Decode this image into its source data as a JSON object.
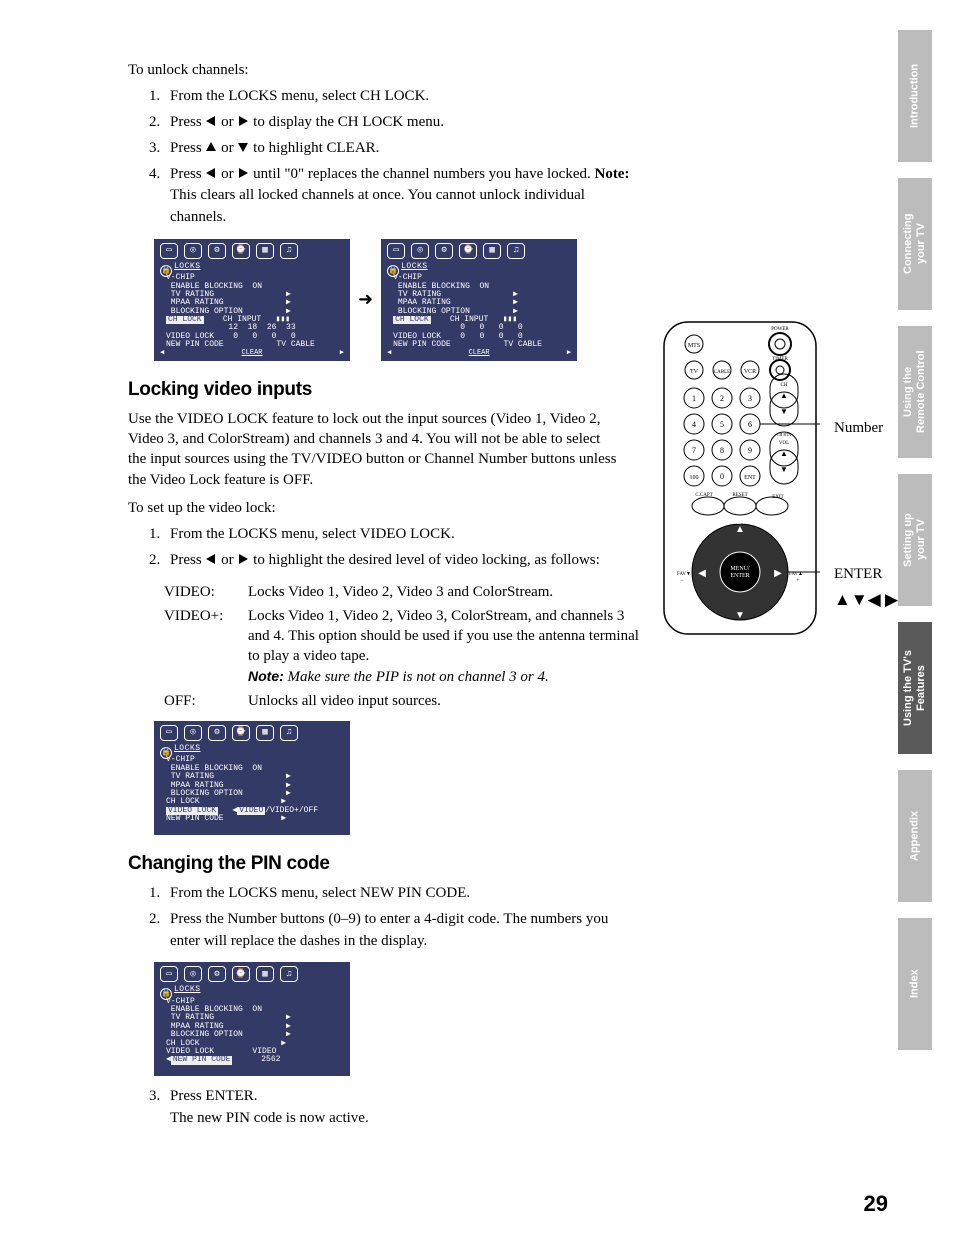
{
  "sideTabs": {
    "t0": "Introduction",
    "t1": "Connecting\nyour TV",
    "t2": "Using the\nRemote Control",
    "t3": "Setting up\nyour TV",
    "t4": "Using the TV's\nFeatures",
    "t5": "Appendix",
    "t6": "Index"
  },
  "unlock": {
    "intro": "To unlock channels:",
    "s1": "From the LOCKS menu, select CH LOCK.",
    "s2a": "Press ",
    "s2b": " or ",
    "s2c": " to display the CH LOCK menu.",
    "s3a": "Press ",
    "s3b": " or ",
    "s3c": " to highlight CLEAR.",
    "s4a": "Press ",
    "s4b": " or ",
    "s4c": " until \"0\" replaces the channel numbers you have locked. ",
    "s4note": "Note:",
    "s4d": " This clears all locked channels at once. You cannot unlock individual channels."
  },
  "osd": {
    "title": "LOCKS",
    "l1": "V-CHIP",
    "l2": " ENABLE BLOCKING  ON",
    "l3": " TV RATING               ▶",
    "l4": " MPAA RATING             ▶",
    "l5": " BLOCKING OPTION         ▶",
    "chlock": "CH LOCK",
    "chinput": "CH INPUT   ▮▮▮",
    "row_a": "             12  18  26  33",
    "row_b": "VIDEO LOCK    0   0   0   0",
    "row_c": "NEW PIN CODE           TV CABLE",
    "row_b0": "              0   0   0   0",
    "row_c0": "VIDEO LOCK    0   0   0   0",
    "clear": "CLEAR",
    "vlockHL": "VIDEO LOCK",
    "videoHL": "VIDEO",
    "vopts": "/VIDEO+/OFF",
    "chlock_plain": "CH LOCK                 ▶",
    "vlock_plain": "VIDEO LOCK        VIDEO",
    "newpin_hl": "NEW PIN CODE",
    "newpin_val": "      2562"
  },
  "locking": {
    "heading": "Locking video inputs",
    "p1": "Use the VIDEO LOCK feature to lock out the input sources (Video 1, Video 2, Video 3, and ColorStream) and channels 3 and 4. You will not be able to select the input sources using the TV/VIDEO button or Channel Number buttons unless the Video Lock feature is OFF.",
    "p2": "To set up the video lock:",
    "s1": "From the LOCKS menu, select VIDEO LOCK.",
    "s2a": "Press ",
    "s2b": " or ",
    "s2c": " to highlight the desired level of video locking, as follows:",
    "video_l": "VIDEO:",
    "video_b": "Locks Video 1, Video 2, Video 3 and ColorStream.",
    "videop_l": "VIDEO+:",
    "videop_b": "Locks Video 1, Video 2, Video 3, ColorStream, and channels 3 and 4. This option should be used if you use the antenna terminal to play a video tape.",
    "note_w": "Note:",
    "note_b": " Make sure the PIP is not on channel 3 or 4.",
    "off_l": "OFF:",
    "off_b": "Unlocks all video input sources."
  },
  "pin": {
    "heading": "Changing the PIN code",
    "s1": "From the LOCKS menu, select NEW PIN CODE.",
    "s2": "Press the Number buttons (0–9) to enter a 4-digit code. The numbers you enter will replace the dashes in the display.",
    "s3": "Press ENTER.\nThe new PIN code is now active."
  },
  "remote": {
    "numberLabel": "Number",
    "enterLabel": "ENTER",
    "arrowsLabel": "▲▼◀ ▶"
  },
  "pageNumber": "29"
}
